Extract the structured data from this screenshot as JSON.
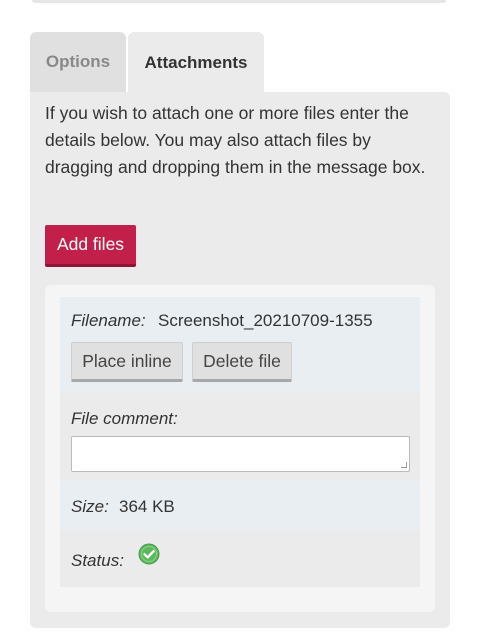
{
  "tabs": [
    {
      "label": "Options",
      "active": false
    },
    {
      "label": "Attachments",
      "active": true
    }
  ],
  "intro_text": "If you wish to attach one or more files enter the details below. You may also attach files by dragging and dropping them in the message box.",
  "add_files_label": "Add files",
  "file": {
    "filename_label": "Filename:",
    "filename_value": "Screenshot_20210709-1355",
    "place_inline_label": "Place inline",
    "delete_file_label": "Delete file",
    "comment_label": "File comment:",
    "comment_value": "",
    "size_label": "Size:",
    "size_value": "364 KB",
    "status_label": "Status:",
    "status_icon": "check-circle-icon"
  },
  "colors": {
    "accent": "#c2204a",
    "status_ok": "#5cb85c"
  }
}
